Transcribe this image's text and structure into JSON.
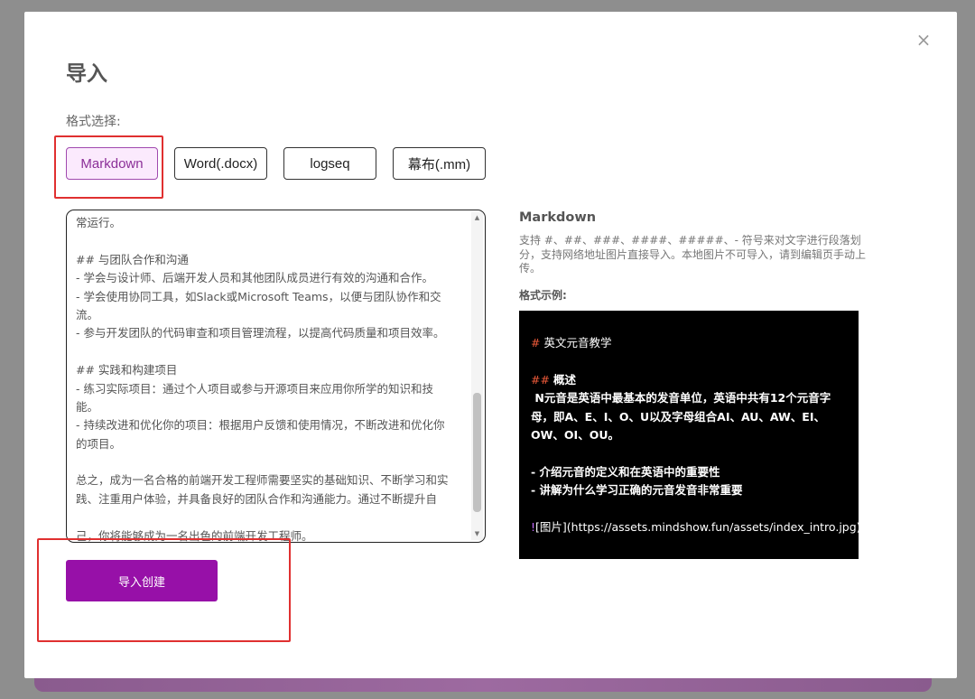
{
  "dialog": {
    "title": "导入",
    "close_glyph": "×",
    "format_label": "格式选择:"
  },
  "formats": [
    {
      "label": "Markdown",
      "active": true
    },
    {
      "label": "Word(.docx)",
      "active": false
    },
    {
      "label": "logseq",
      "active": false
    },
    {
      "label": "幕布(.mm)",
      "active": false
    }
  ],
  "editor": {
    "lines": [
      "常运行。",
      "",
      "## 与团队合作和沟通",
      "- 学会与设计师、后端开发人员和其他团队成员进行有效的沟通和合作。",
      "- 学会使用协同工具，如Slack或Microsoft Teams，以便与团队协作和交",
      "流。",
      "- 参与开发团队的代码审查和项目管理流程，以提高代码质量和项目效率。",
      "",
      "## 实践和构建项目",
      "- 练习实际项目：通过个人项目或参与开源项目来应用你所学的知识和技",
      "能。",
      "- 持续改进和优化你的项目：根据用户反馈和使用情况，不断改进和优化你",
      "的项目。",
      "",
      "总之，成为一名合格的前端开发工程师需要坚实的基础知识、不断学习和实",
      "践、注重用户体验，并具备良好的团队合作和沟通能力。通过不断提升自",
      "",
      "己，你将能够成为一名出色的前端开发工程师。"
    ]
  },
  "import_button": {
    "label": "导入创建"
  },
  "info": {
    "title": "Markdown",
    "description": "支持 #、##、###、####、#####、- 符号来对文字进行段落划分，支持网络地址图片直接导入。本地图片不可导入，请到编辑页手动上传。",
    "example_label": "格式示例:"
  },
  "example": {
    "h1_mark": "#",
    "h1_text": "英文元音教学",
    "h2_mark": "##",
    "h2_text": "概述",
    "para1": " N元音是英语中最基本的发音单位，英语中共有12个元音字",
    "para2": "母，即A、E、I、O、U以及字母组合AI、AU、AW、EI、",
    "para3": "OW、OI、OU。",
    "bullet1": "- 介绍元音的定义和在英语中的重要性",
    "bullet2": "- 讲解为什么学习正确的元音发音非常重要",
    "img_bang": "!",
    "img_text": "[图片](https://assets.mindshow.fun/assets/index_intro.jpg)"
  },
  "colors": {
    "accent": "#9710a8",
    "active_button_bg": "#fbeafd",
    "highlight_box": "#e03030",
    "example_bg": "#000000"
  }
}
